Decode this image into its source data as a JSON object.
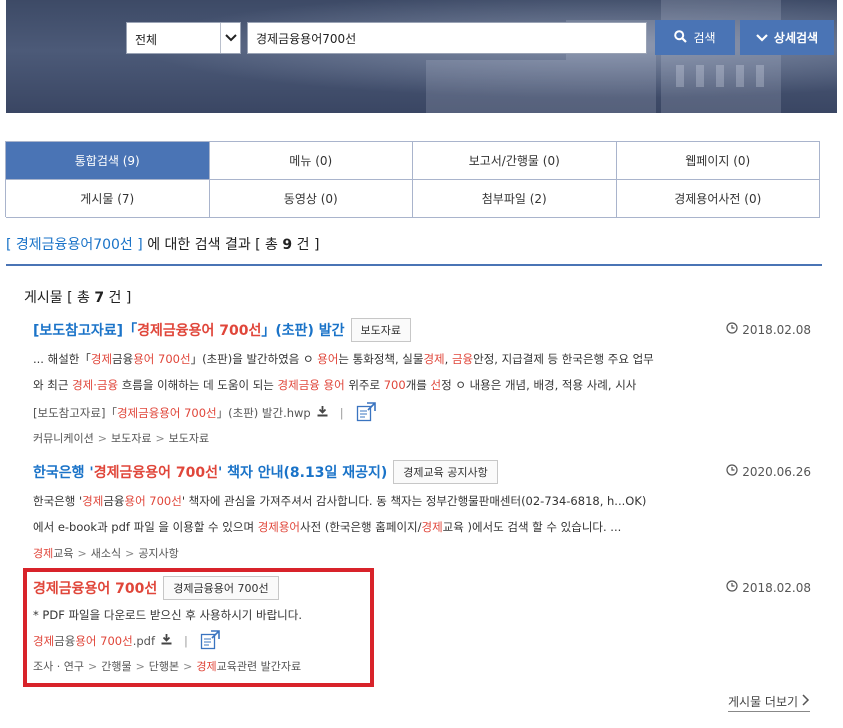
{
  "search": {
    "scope_selected": "전체",
    "query": "경제금융용어700선",
    "search_button": "검색",
    "detail_button": "상세검색"
  },
  "categories": [
    {
      "label": "통합검색 (9)",
      "active": true
    },
    {
      "label": "메뉴 (0)"
    },
    {
      "label": "보고서/간행물 (0)"
    },
    {
      "label": "웹페이지 (0)"
    },
    {
      "label": "게시물 (7)"
    },
    {
      "label": "동영상 (0)"
    },
    {
      "label": "첨부파일 (2)"
    },
    {
      "label": "경제용어사전 (0)"
    }
  ],
  "summary": {
    "open": "[",
    "keyword": "경제금융용어700선",
    "close": "]",
    "text": "에 대한 검색 결과 [ 총",
    "count": "9",
    "unit": "건 ]"
  },
  "section": {
    "prefix": "게시물 [ 총",
    "count": "7",
    "suffix": "건 ]"
  },
  "results": [
    {
      "title_pre": "[보도참고자료]「",
      "title_hl": "경제금융용어 700선",
      "title_post": "」(초판) 발간",
      "tag": "보도자료",
      "date": "2018.02.08",
      "line1_a": "... 해설한「",
      "line1_b": "경제",
      "line1_c": "금융",
      "line1_d": "용어 700선",
      "line1_e": "」(초판)을 발간하였음 ㅇ ",
      "line1_f": "용어",
      "line1_g": "는 통화정책, 실물",
      "line1_h": "경제",
      "line1_i": ", ",
      "line1_j": "금융",
      "line1_k": "안정, 지급결제 등 한국은행 주요 업무",
      "line2_a": "와 최근 ",
      "line2_b": "경제·금융",
      "line2_c": " 흐름을 이해하는 데 도움이 되는 ",
      "line2_d": "경제금융 용어",
      "line2_e": " 위주로 ",
      "line2_f": "700",
      "line2_g": "개를 ",
      "line2_h": "선",
      "line2_i": "정 ㅇ 내용은 개념, 배경, 적용 사례, 시사",
      "file_pre": "[보도참고자료]「",
      "file_hl": "경제금융용어 700선",
      "file_post": "」(초판) 발간.hwp",
      "path": [
        "커뮤니케이션",
        "보도자료",
        "보도자료"
      ]
    },
    {
      "title_pre": "한국은행 '",
      "title_hl": "경제금융용어 700선",
      "title_post": "' 책자 안내(8.13일 재공지)",
      "tag": "경제교육 공지사항",
      "date": "2020.06.26",
      "line1_a": "한국은행 '",
      "line1_b": "경제",
      "line1_c": "금융",
      "line1_d": "용어 700선",
      "line1_e": "' 책자에 관심을 가져주셔서 감사합니다. 동 책자는 정부간행물판매센터(02-734-6818, h...OK)",
      "line2_a": "에서 e-book과 pdf 파일 을 이용할 수 있으며 ",
      "line2_b": "경제용어",
      "line2_c": "사전 (한국은행 홈페이지/",
      "line2_d": "경제",
      "line2_e": "교육 )에서도 검색 할 수 있습니다. ...",
      "path_hl": "경제",
      "path_first": "교육",
      "path": [
        "새소식",
        "공지사항"
      ]
    },
    {
      "title_hl": "경제금융용어 700선",
      "tag": "경제금융용어 700선",
      "date": "2018.02.08",
      "line1": "* PDF 파일을 다운로드 받으신 후 사용하시기 바랍니다.",
      "file_hl1": "경제",
      "file_mid1": "금융",
      "file_hl2": "용어 700선",
      "file_post": ".pdf",
      "path": [
        "조사 · 연구",
        "간행물",
        "단행본"
      ],
      "path_last_hl": "경제",
      "path_last_rest": "교육관련 발간자료"
    }
  ],
  "more_link": "게시물 더보기",
  "colors": {
    "accent": "#4a74b5",
    "link_blue": "#1a73c8",
    "highlight_red": "#e0463a",
    "annotation_red": "#d8232a"
  },
  "icons": [
    "chevron-down-icon",
    "search-icon",
    "clock-icon",
    "download-icon",
    "external-view-icon",
    "chevron-right-icon"
  ]
}
